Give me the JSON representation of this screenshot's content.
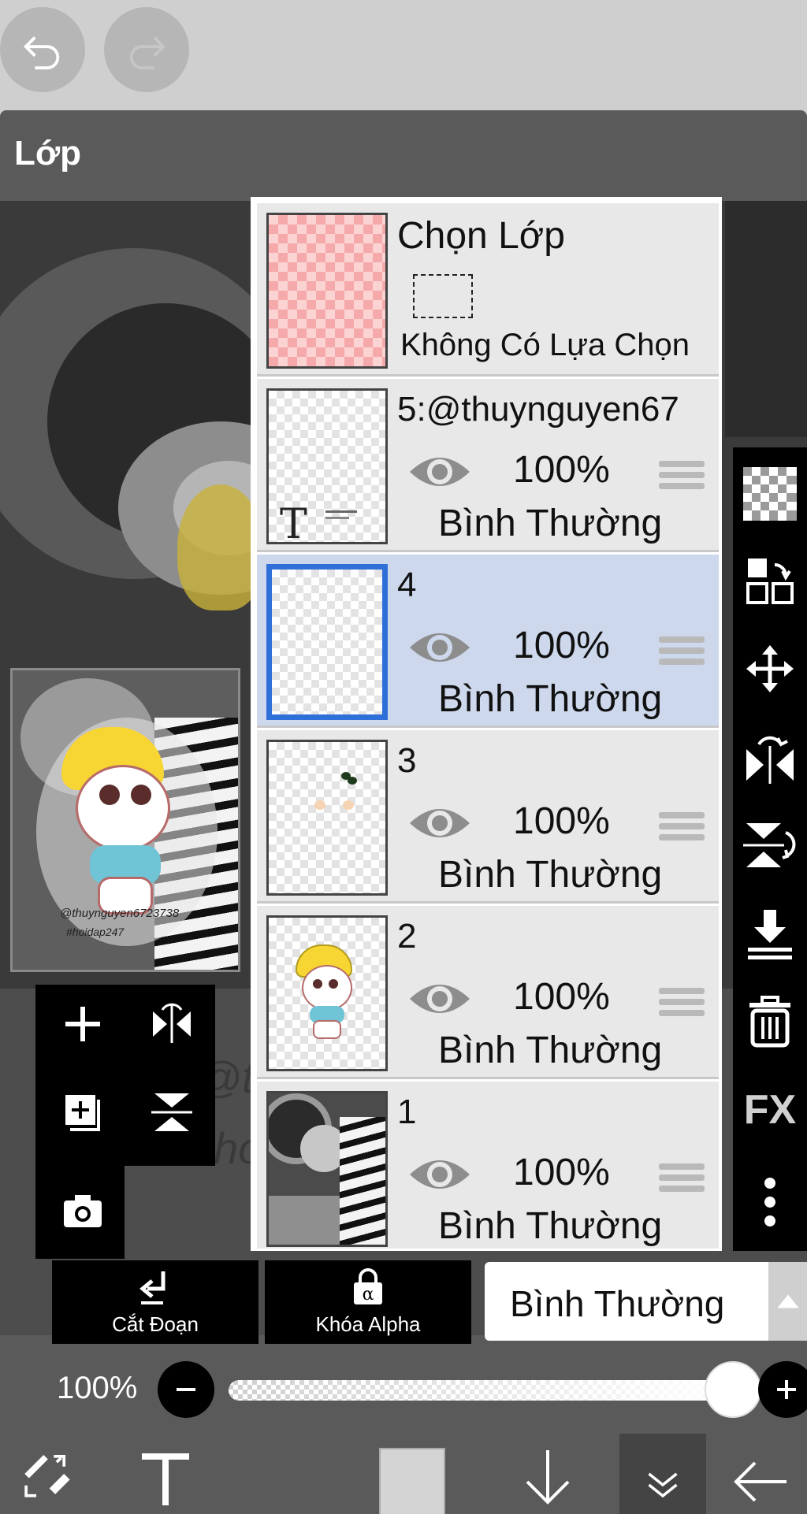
{
  "window": {
    "title": "Lớp"
  },
  "selection_layer": {
    "title": "Chọn Lớp",
    "status": "Không Có Lựa Chọn"
  },
  "layers": [
    {
      "name": "5:@thuynguyen67",
      "opacity": "100%",
      "blend": "Bình Thường",
      "visible": true,
      "selected": false,
      "type": "text"
    },
    {
      "name": "4",
      "opacity": "100%",
      "blend": "Bình Thường",
      "visible": true,
      "selected": true,
      "type": "empty"
    },
    {
      "name": "3",
      "opacity": "100%",
      "blend": "Bình Thường",
      "visible": true,
      "selected": false,
      "type": "parts"
    },
    {
      "name": "2",
      "opacity": "100%",
      "blend": "Bình Thường",
      "visible": true,
      "selected": false,
      "type": "character"
    },
    {
      "name": "1",
      "opacity": "100%",
      "blend": "Bình Thường",
      "visible": true,
      "selected": false,
      "type": "photo"
    }
  ],
  "preview": {
    "watermark_line1": "@thuynguyen6723738",
    "watermark_line2": "#hoidap247"
  },
  "canvas_watermark": {
    "line1": "@th",
    "line2": "#ho"
  },
  "actions": {
    "clipping_label": "Cắt Đoạn",
    "alpha_lock_label": "Khóa Alpha"
  },
  "blend_mode": {
    "value": "Bình Thường"
  },
  "opacity_control": {
    "label": "100%",
    "value": 1.0
  },
  "right_toolbar": {
    "fx_label": "FX"
  },
  "colors": {
    "accent": "#2f6fd8",
    "selected_row": "#cdd8ec",
    "panel_black": "#000000"
  }
}
